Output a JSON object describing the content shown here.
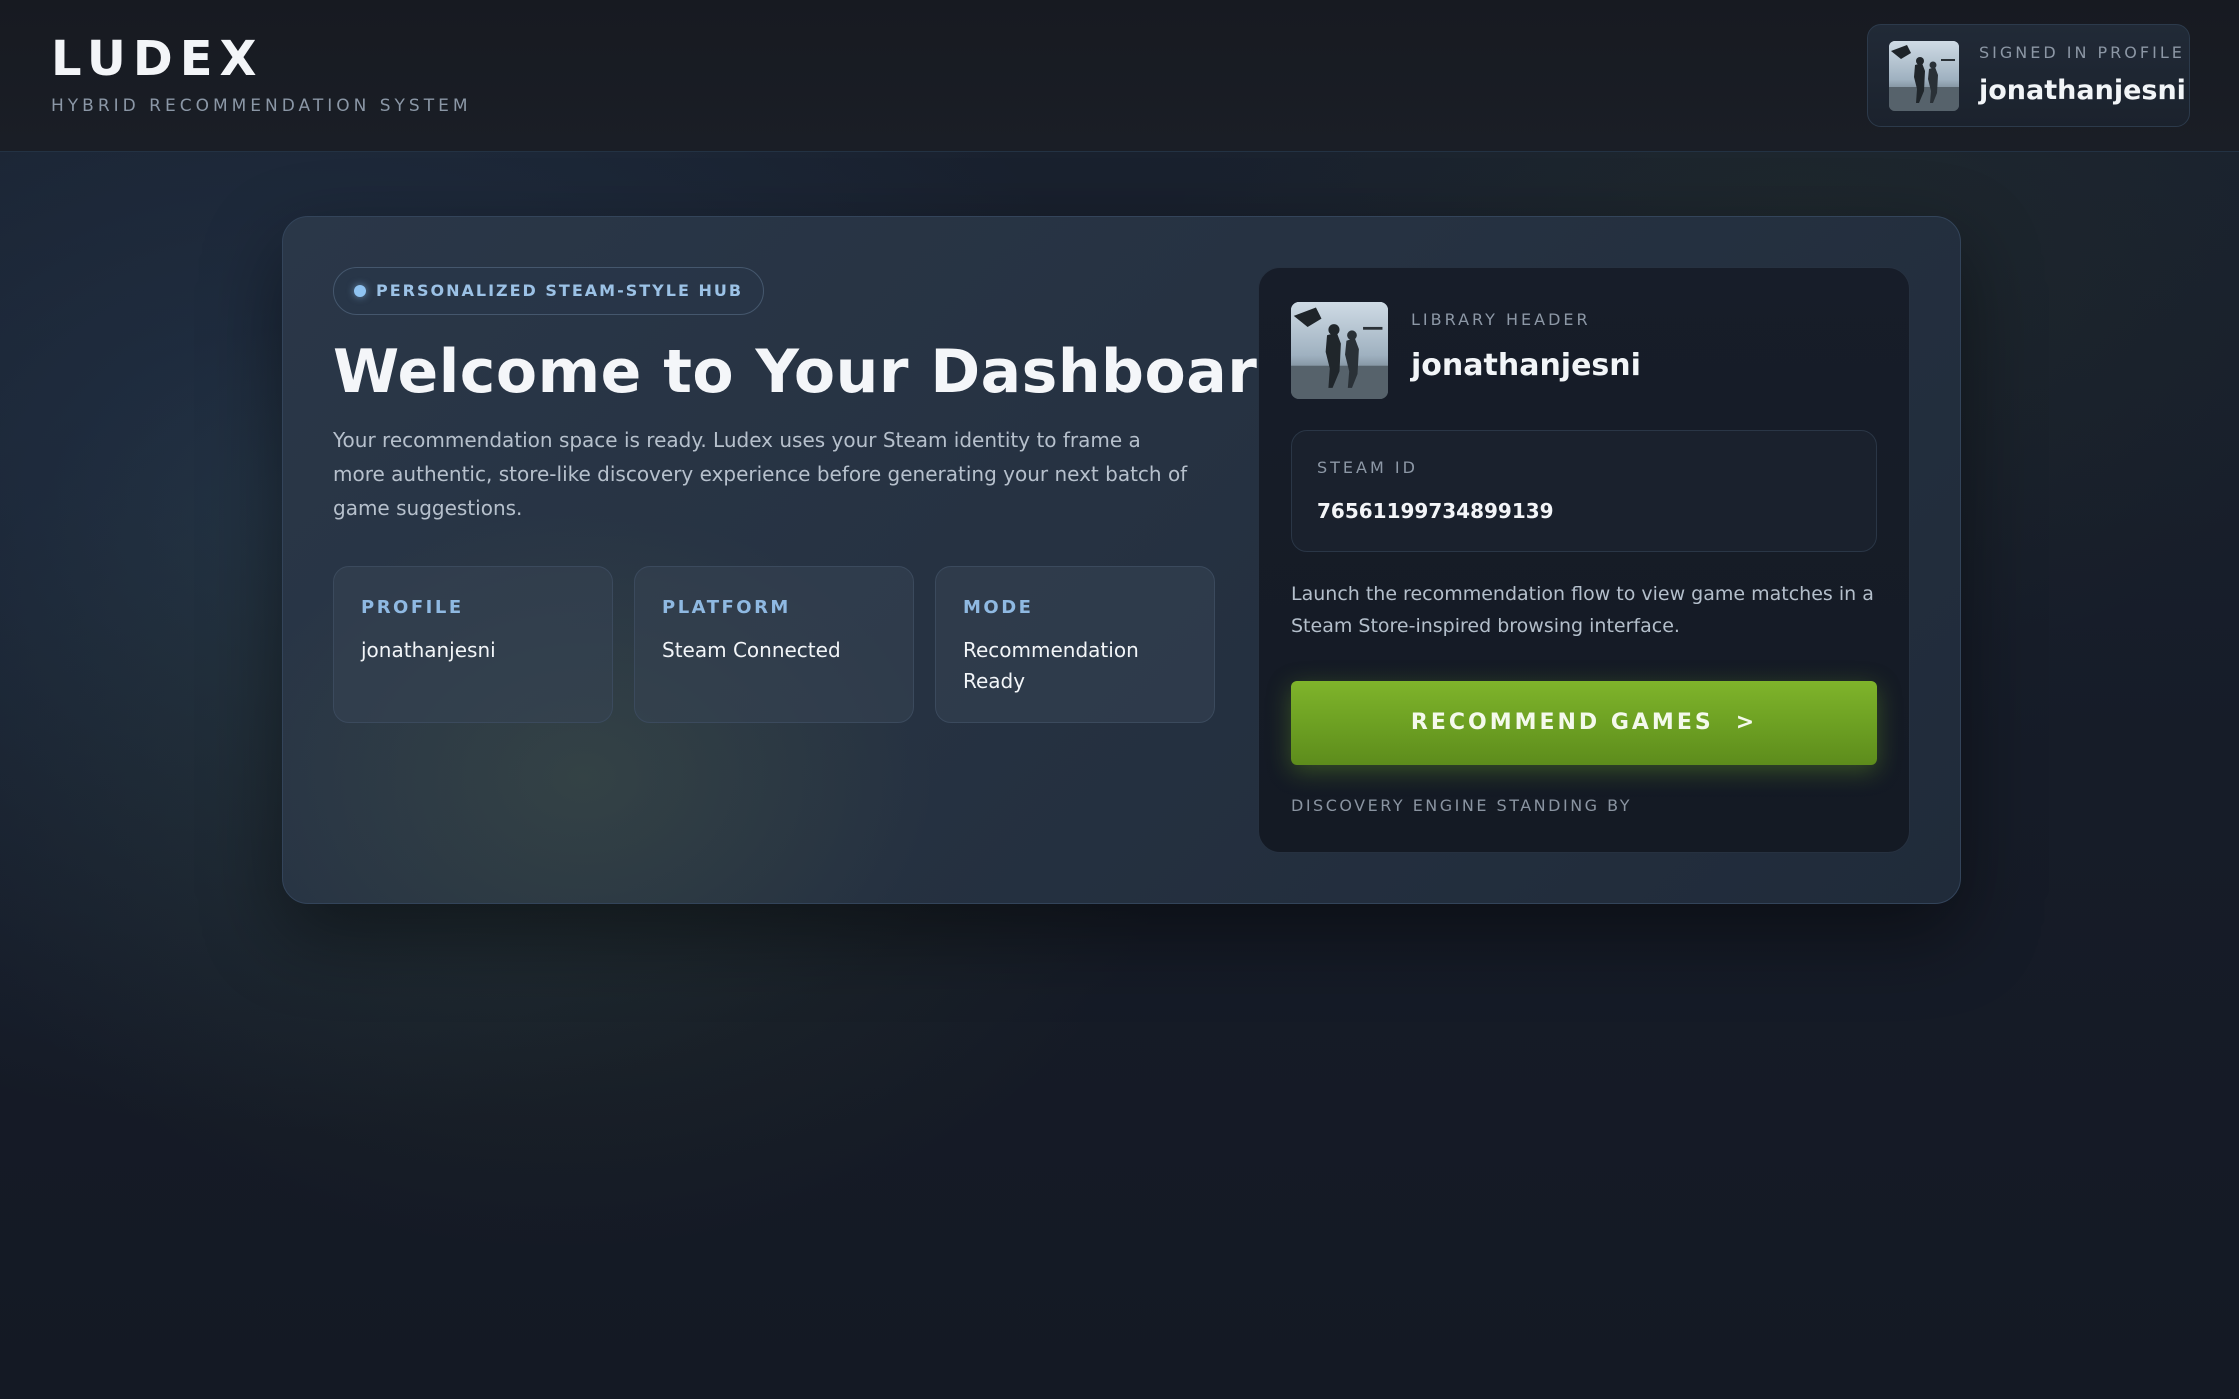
{
  "header": {
    "brand": "LUDEX",
    "subtitle": "HYBRID RECOMMENDATION SYSTEM",
    "profile_chip": {
      "label": "SIGNED IN PROFILE",
      "username": "jonathanjesni"
    }
  },
  "hero": {
    "pill": "PERSONALIZED STEAM-STYLE HUB",
    "title": "Welcome to Your Dashboard",
    "description": "Your recommendation space is ready. Ludex uses your Steam identity to frame a more authentic, store-like discovery experience before generating your next batch of game suggestions.",
    "stats": [
      {
        "label": "PROFILE",
        "value": "jonathanjesni"
      },
      {
        "label": "PLATFORM",
        "value": "Steam Connected"
      },
      {
        "label": "MODE",
        "value": "Recommendation Ready"
      }
    ]
  },
  "library": {
    "label": "LIBRARY HEADER",
    "username": "jonathanjesni",
    "steam_id_label": "STEAM ID",
    "steam_id": "76561199734899139",
    "description": "Launch the recommendation flow to view game matches in a Steam Store-inspired browsing interface.",
    "button_label": "RECOMMEND GAMES",
    "button_chevron": ">",
    "status": "DISCOVERY ENGINE STANDING BY"
  },
  "colors": {
    "accent_green": "#6c9f22",
    "accent_blue": "#8fb9e2",
    "panel_dark": "#141a24"
  },
  "icons": {
    "avatar": "soldier-avatar-image",
    "pill_dot": "status-dot-icon",
    "button": "chevron-right-icon"
  }
}
